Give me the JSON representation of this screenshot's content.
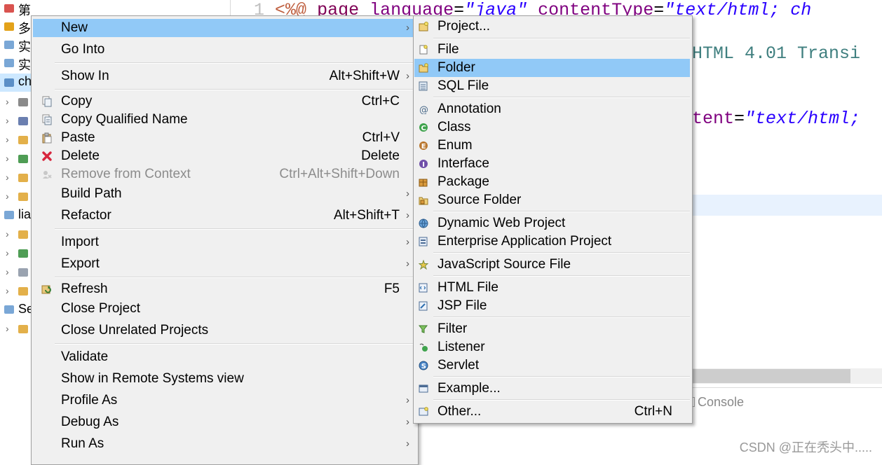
{
  "explorer": {
    "rows": [
      {
        "label": "第一章",
        "expand": ""
      },
      {
        "label": "多",
        "expand": ""
      },
      {
        "label": "实",
        "expand": ""
      },
      {
        "label": "实",
        "expand": ""
      },
      {
        "label": "ch",
        "expand": ""
      },
      {
        "label": "",
        "expand": "›"
      },
      {
        "label": "",
        "expand": "›"
      },
      {
        "label": "",
        "expand": "›"
      },
      {
        "label": "",
        "expand": "›"
      },
      {
        "label": "",
        "expand": "›"
      },
      {
        "label": "",
        "expand": "›"
      },
      {
        "label": "lia",
        "expand": ""
      },
      {
        "label": "",
        "expand": "›"
      },
      {
        "label": "",
        "expand": "›"
      },
      {
        "label": "",
        "expand": "›"
      },
      {
        "label": "",
        "expand": "›"
      },
      {
        "label": "Se",
        "expand": ""
      },
      {
        "label": "",
        "expand": "›"
      }
    ]
  },
  "editor": {
    "line_number": "1",
    "line1": {
      "open": "<%@",
      "directive": "page",
      "attr1": "language",
      "eq1": "=",
      "val1": "\"java\"",
      "attr2": "contentType",
      "eq2": "=",
      "val2": "\"text/html; ch"
    },
    "line2_fragment": "HTML 4.01 Transi",
    "line3_fragment": {
      "attr": "tent",
      "eq": "=",
      "val": "\"text/html;"
    }
  },
  "bottom": {
    "console_tab": "Console",
    "watermark": "CSDN @正在秃头中....."
  },
  "context_menu": {
    "items": [
      {
        "label": "New",
        "shortcut": "",
        "arrow": "›",
        "icon": "",
        "highlight": true
      },
      {
        "label": "Go Into",
        "shortcut": "",
        "arrow": "",
        "icon": ""
      },
      {
        "label": "Show In",
        "shortcut": "Alt+Shift+W",
        "arrow": "›",
        "icon": ""
      },
      {
        "label": "Copy",
        "shortcut": "Ctrl+C",
        "arrow": "",
        "icon": "copy-icon"
      },
      {
        "label": "Copy Qualified Name",
        "shortcut": "",
        "arrow": "",
        "icon": "copy-qualified-name-icon"
      },
      {
        "label": "Paste",
        "shortcut": "Ctrl+V",
        "arrow": "",
        "icon": "paste-icon"
      },
      {
        "label": "Delete",
        "shortcut": "Delete",
        "arrow": "",
        "icon": "delete-icon"
      },
      {
        "label": "Remove from Context",
        "shortcut": "Ctrl+Alt+Shift+Down",
        "arrow": "",
        "icon": "remove-context-icon",
        "disabled": true
      },
      {
        "label": "Build Path",
        "shortcut": "",
        "arrow": "›",
        "icon": ""
      },
      {
        "label": "Refactor",
        "shortcut": "Alt+Shift+T",
        "arrow": "›",
        "icon": ""
      },
      {
        "label": "Import",
        "shortcut": "",
        "arrow": "›",
        "icon": ""
      },
      {
        "label": "Export",
        "shortcut": "",
        "arrow": "›",
        "icon": ""
      },
      {
        "label": "Refresh",
        "shortcut": "F5",
        "arrow": "",
        "icon": "refresh-icon"
      },
      {
        "label": "Close Project",
        "shortcut": "",
        "arrow": "",
        "icon": ""
      },
      {
        "label": "Close Unrelated Projects",
        "shortcut": "",
        "arrow": "",
        "icon": ""
      },
      {
        "label": "Validate",
        "shortcut": "",
        "arrow": "",
        "icon": ""
      },
      {
        "label": "Show in Remote Systems view",
        "shortcut": "",
        "arrow": "",
        "icon": ""
      },
      {
        "label": "Profile As",
        "shortcut": "",
        "arrow": "›",
        "icon": ""
      },
      {
        "label": "Debug As",
        "shortcut": "",
        "arrow": "›",
        "icon": ""
      },
      {
        "label": "Run As",
        "shortcut": "",
        "arrow": "›",
        "icon": ""
      }
    ]
  },
  "new_submenu": {
    "items": [
      {
        "label": "Project...",
        "shortcut": "",
        "icon": "project-icon"
      },
      {
        "label": "File",
        "shortcut": "",
        "icon": "file-icon"
      },
      {
        "label": "Folder",
        "shortcut": "",
        "icon": "folder-icon",
        "highlight": true
      },
      {
        "label": "SQL File",
        "shortcut": "",
        "icon": "sql-file-icon"
      },
      {
        "label": "Annotation",
        "shortcut": "",
        "icon": "annotation-icon"
      },
      {
        "label": "Class",
        "shortcut": "",
        "icon": "class-icon"
      },
      {
        "label": "Enum",
        "shortcut": "",
        "icon": "enum-icon"
      },
      {
        "label": "Interface",
        "shortcut": "",
        "icon": "interface-icon"
      },
      {
        "label": "Package",
        "shortcut": "",
        "icon": "package-icon"
      },
      {
        "label": "Source Folder",
        "shortcut": "",
        "icon": "source-folder-icon"
      },
      {
        "label": "Dynamic Web Project",
        "shortcut": "",
        "icon": "dynamic-web-project-icon"
      },
      {
        "label": "Enterprise Application Project",
        "shortcut": "",
        "icon": "enterprise-application-project-icon"
      },
      {
        "label": "JavaScript Source File",
        "shortcut": "",
        "icon": "javascript-source-file-icon"
      },
      {
        "label": "HTML File",
        "shortcut": "",
        "icon": "html-file-icon"
      },
      {
        "label": "JSP File",
        "shortcut": "",
        "icon": "jsp-file-icon"
      },
      {
        "label": "Filter",
        "shortcut": "",
        "icon": "filter-icon"
      },
      {
        "label": "Listener",
        "shortcut": "",
        "icon": "listener-icon"
      },
      {
        "label": "Servlet",
        "shortcut": "",
        "icon": "servlet-icon"
      },
      {
        "label": "Example...",
        "shortcut": "",
        "icon": "example-icon"
      },
      {
        "label": "Other...",
        "shortcut": "Ctrl+N",
        "icon": "other-icon"
      }
    ]
  },
  "colors": {
    "menu_bg": "#f0f0f0",
    "menu_highlight": "#91c9f7",
    "disabled_text": "#8c8c8c",
    "keyword_purple": "#7f0055",
    "string_blue": "#2a00ff",
    "teal_text": "#3f7f7f",
    "line_number": "#787878"
  }
}
